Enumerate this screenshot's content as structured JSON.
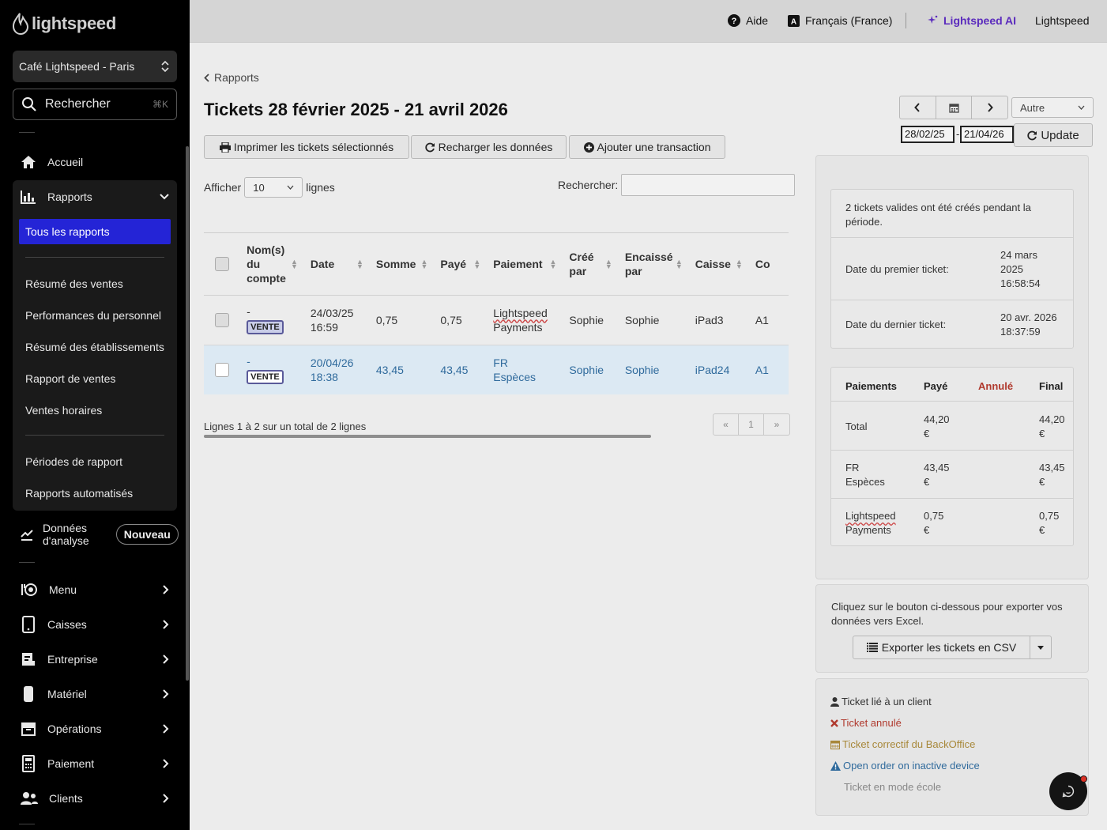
{
  "brand": {
    "name": "lightspeed"
  },
  "sidebar": {
    "store_name": "Café Lightspeed - Paris",
    "search_label": "Rechercher",
    "search_shortcut": "⌘K",
    "home": "Accueil",
    "reports": "Rapports",
    "reports_sub": {
      "active": "Tous les rapports",
      "items": [
        "Résumé des ventes",
        "Performances du personnel",
        "Résumé des établissements",
        "Rapport de ventes",
        "Ventes horaires"
      ],
      "items2": [
        "Périodes de rapport",
        "Rapports automatisés"
      ]
    },
    "analytics": {
      "line1": "Données",
      "line2": "d'analyse",
      "badge": "Nouveau"
    },
    "nav": [
      "Menu",
      "Caisses",
      "Entreprise",
      "Matériel",
      "Opérations",
      "Paiement",
      "Clients"
    ]
  },
  "topbar": {
    "help": "Aide",
    "language": "Français (France)",
    "ai": "Lightspeed AI",
    "account": "Lightspeed"
  },
  "page": {
    "breadcrumb": "Rapports",
    "title": "Tickets 28 février 2025 - 21 avril 2026",
    "actions": {
      "print": "Imprimer les tickets sélectionnés",
      "reload": "Recharger les données",
      "add": "Ajouter une transaction"
    },
    "period_select": "Autre",
    "date_from": "28/02/25",
    "date_to": "21/04/26",
    "update": "Update",
    "show_label": "Afficher",
    "show_value": "10",
    "lines_label": "lignes",
    "search_label": "Rechercher:"
  },
  "table": {
    "headers": [
      "Nom(s) du compte",
      "Date",
      "Somme",
      "Payé",
      "Paiement",
      "Créé par",
      "Encaissé par",
      "Caisse",
      "Co"
    ],
    "rows": [
      {
        "account": "-",
        "type": "VENTE",
        "date": "24/03/25",
        "time": "16:59",
        "sum": "0,75",
        "paid": "0,75",
        "payment1": "Lightspeed",
        "payment2": "Payments",
        "created_by": "Sophie",
        "cashed_by": "Sophie",
        "register": "iPad3",
        "co": "A1"
      },
      {
        "account": "-",
        "type": "VENTE",
        "date": "20/04/26",
        "time": "18:38",
        "sum": "43,45",
        "paid": "43,45",
        "payment1": "FR",
        "payment2": "Espèces",
        "created_by": "Sophie",
        "cashed_by": "Sophie",
        "register": "iPad24",
        "co": "A1"
      }
    ],
    "info": "Lignes 1 à 2 sur un total de 2 lignes",
    "pager": [
      "«",
      "1",
      "»"
    ]
  },
  "summary": {
    "valid_text_1": "2 tickets valides ont été créés pendant la",
    "valid_text_2": "période.",
    "first_label": "Date du premier ticket:",
    "first_value_1": "24 mars",
    "first_value_2": "2025",
    "first_value_3": "16:58:54",
    "last_label": "Date du dernier ticket:",
    "last_value_1": "20 avr. 2026",
    "last_value_2": "18:37:59"
  },
  "payments": {
    "headers": [
      "Paiements",
      "Payé",
      "Annulé",
      "Final"
    ],
    "rows": [
      {
        "name1": "Total",
        "name2": "",
        "paid1": "44,20",
        "paid2": "€",
        "final1": "44,20",
        "final2": "€"
      },
      {
        "name1": "FR",
        "name2": "Espèces",
        "paid1": "43,45",
        "paid2": "€",
        "final1": "43,45",
        "final2": "€"
      },
      {
        "name1": "Lightspeed",
        "name2": "Payments",
        "paid1": "0,75",
        "paid2": "€",
        "final1": "0,75",
        "final2": "€"
      }
    ]
  },
  "export": {
    "text1": "Cliquez sur le bouton ci-dessous pour exporter vos",
    "text2": "données vers Excel.",
    "button": "Exporter les tickets en CSV"
  },
  "legend": {
    "client": "Ticket lié à un client",
    "cancelled": "Ticket annulé",
    "corrective": "Ticket correctif du BackOffice",
    "inactive": "Open order on inactive device",
    "school": "Ticket en mode école"
  },
  "colors": {
    "sidebar_bg": "#000000",
    "active_item": "#2424d6",
    "ai_purple": "#5b2bbd",
    "selected_row": "#dce9f3",
    "link_blue": "#2f6a9c",
    "cancel_red": "#b03a2e",
    "corrective_gold": "#a8883a"
  }
}
